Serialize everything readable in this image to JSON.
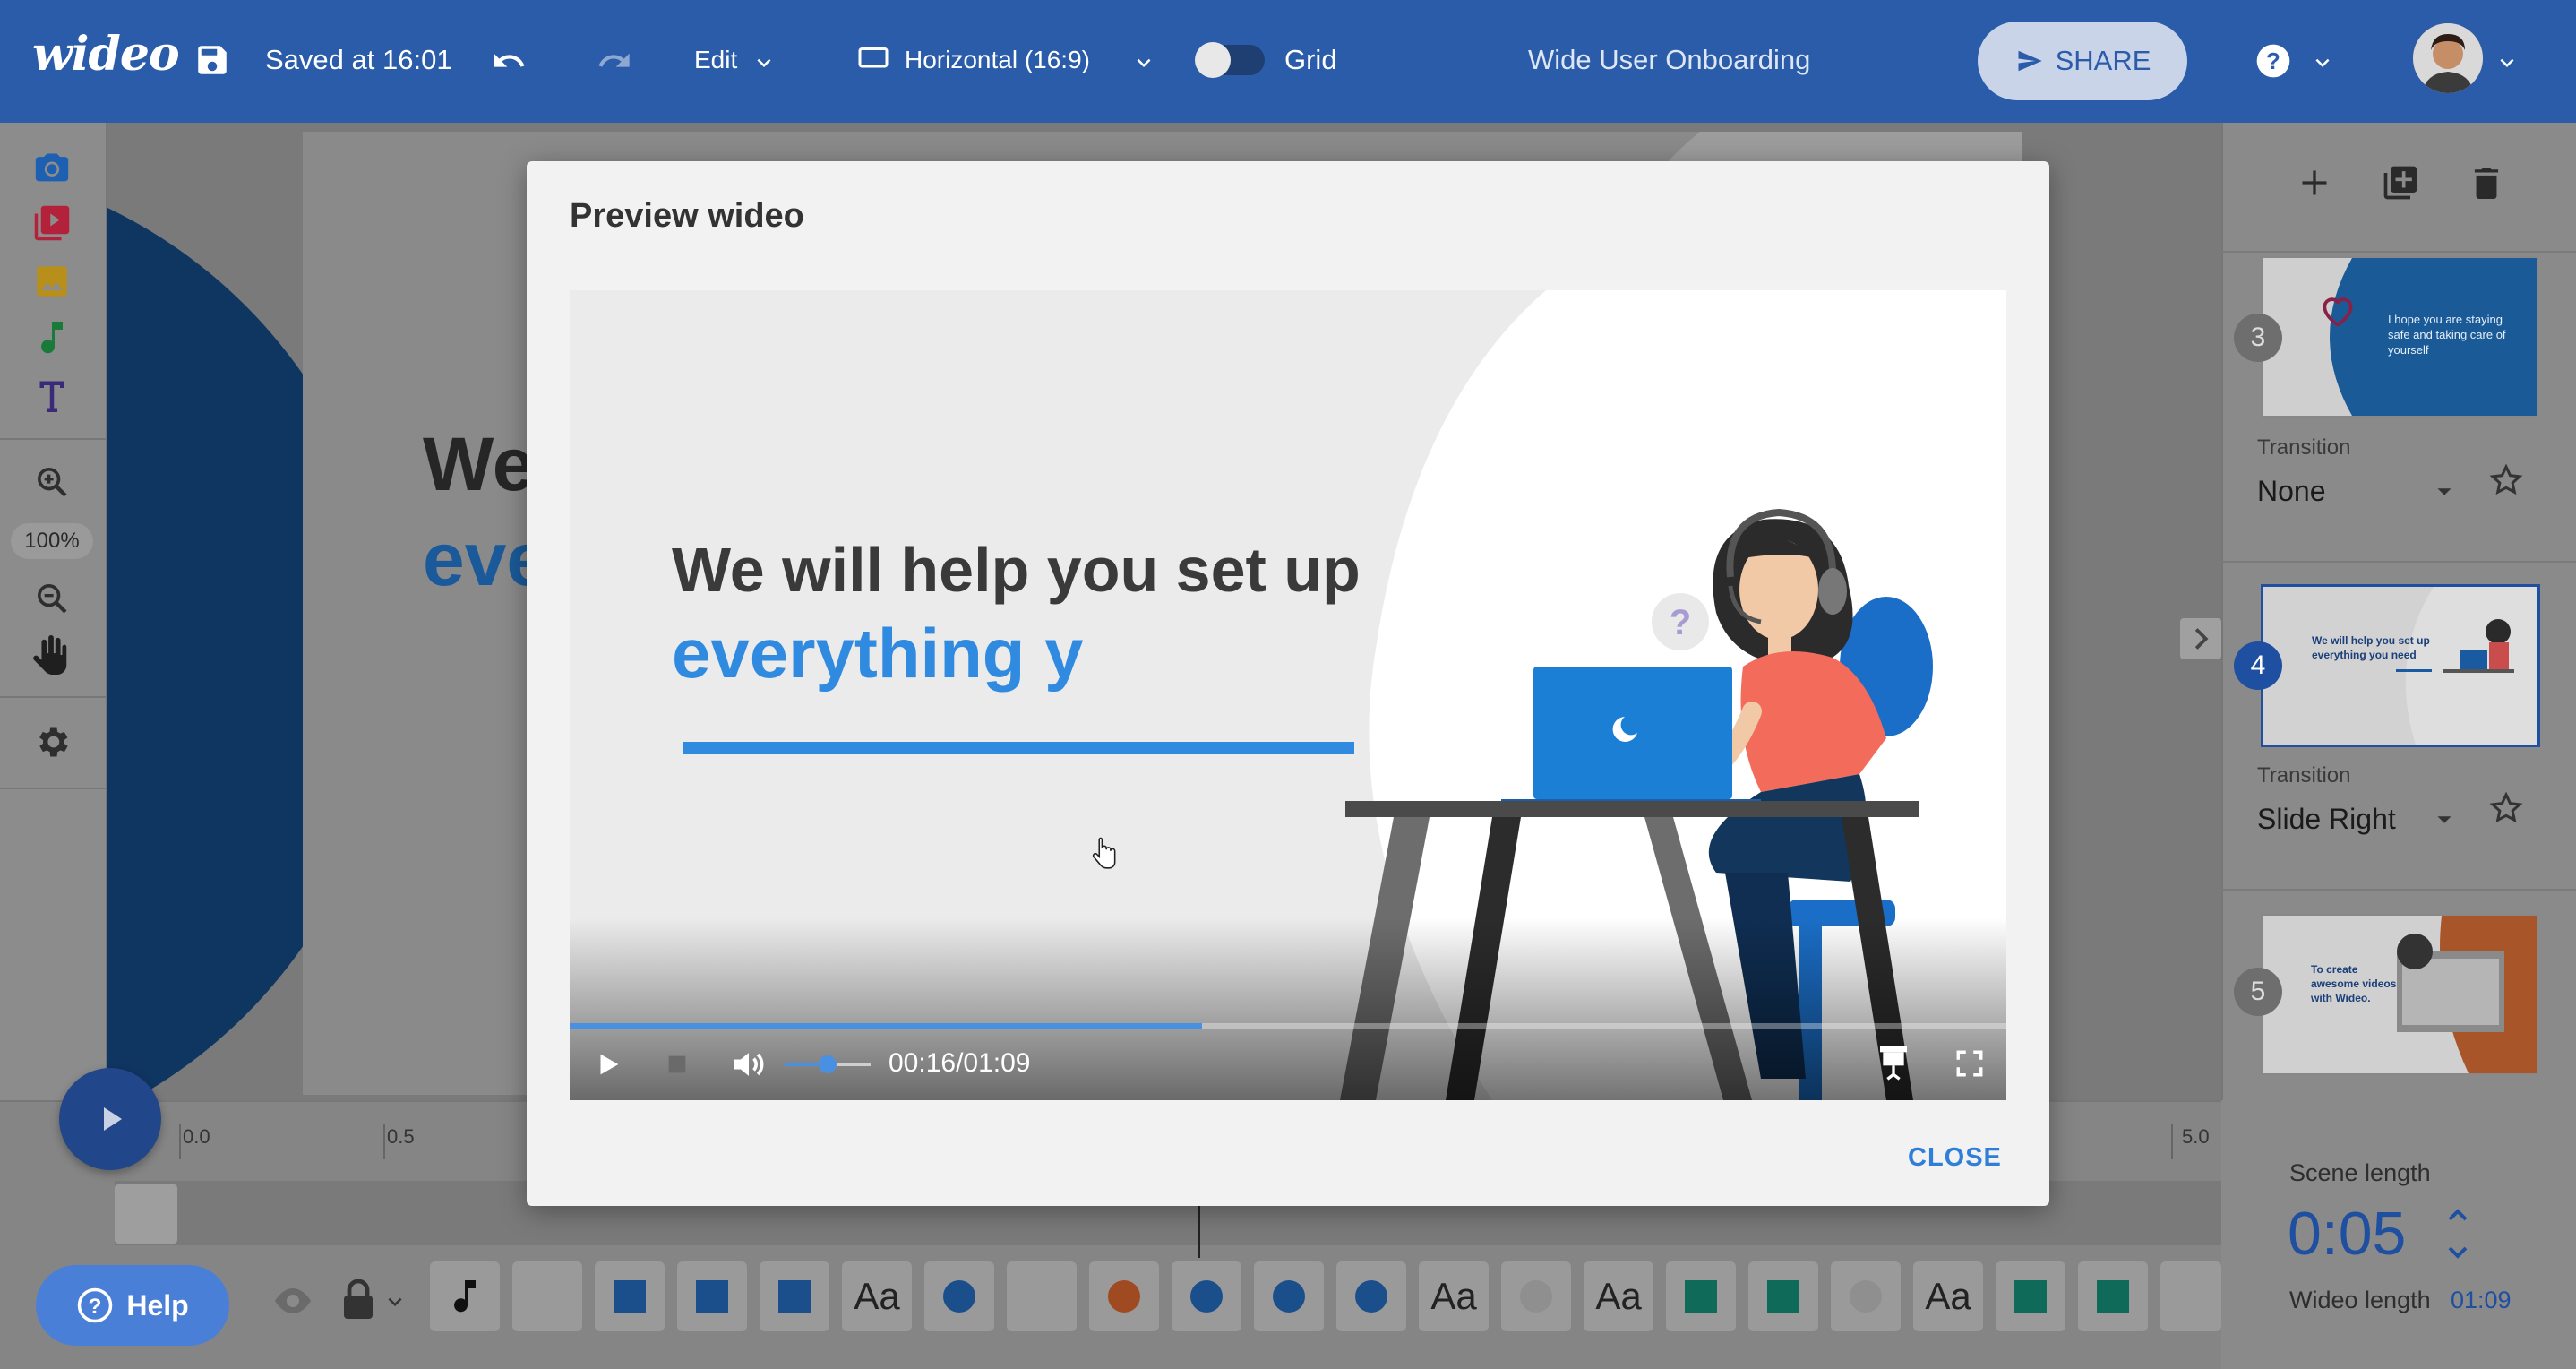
{
  "app": {
    "logo": "wideo",
    "saved_status": "Saved at 16:01",
    "edit_menu": "Edit",
    "aspect_ratio": "Horizontal (16:9)",
    "grid_label": "Grid",
    "project_title": "Wide User Onboarding",
    "share_label": "SHARE"
  },
  "left_toolbar": {
    "zoom_level": "100%"
  },
  "right_panel": {
    "scenes": [
      {
        "number": "3",
        "transition_label": "Transition",
        "transition_value": "None",
        "thumb_text": "I hope you are staying safe and taking care of yourself"
      },
      {
        "number": "4",
        "transition_label": "Transition",
        "transition_value": "Slide Right",
        "thumb_text": "We will help you set up everything you need"
      },
      {
        "number": "5",
        "transition_label": "Transition",
        "transition_value": "",
        "thumb_text": "To create awesome videos with Wideo."
      }
    ],
    "scene_length_label": "Scene length",
    "scene_length_value": "0:05",
    "wideo_length_label": "Wideo length",
    "wideo_length_value": "01:09"
  },
  "timeline": {
    "ticks": [
      "0.0",
      "0.5",
      "5.0"
    ],
    "help_label": "Help",
    "tile_labels": [
      "Aa",
      "Aa",
      "Aa",
      "Aa"
    ]
  },
  "canvas_behind": {
    "line1": "We",
    "line2": "eve"
  },
  "modal": {
    "title": "Preview wideo",
    "headline": "We will help you set up",
    "subline": "everything y",
    "time": "00:16/01:09",
    "progress": 0.44,
    "volume": 0.5,
    "close_label": "CLOSE"
  },
  "colors": {
    "brand_blue": "#2a5caa",
    "accent_blue": "#2f8ae0",
    "text_dark": "#333333"
  }
}
